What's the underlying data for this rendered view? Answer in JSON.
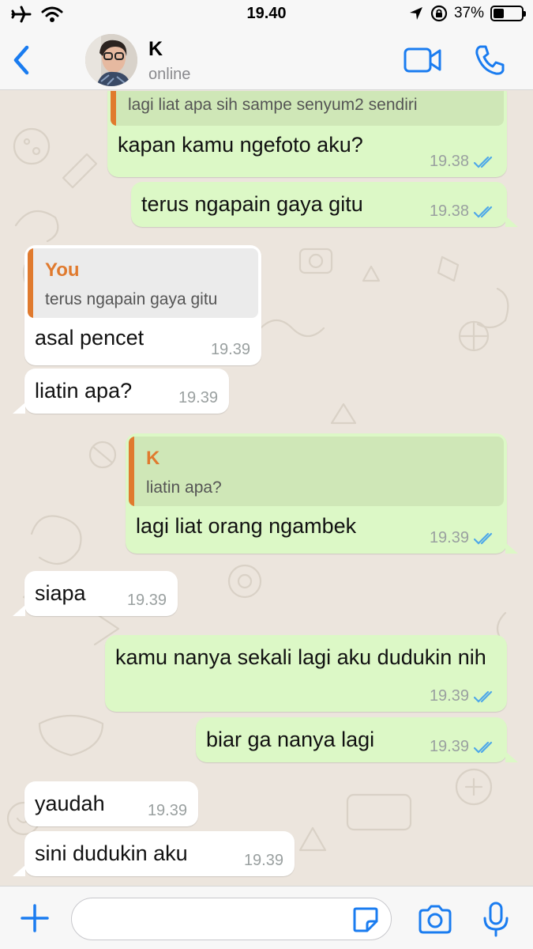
{
  "status_bar": {
    "time": "19.40",
    "battery_percent_label": "37%",
    "battery_level": 0.37,
    "icons": [
      "airplane-icon",
      "wifi-icon",
      "location-icon",
      "rotation-lock-icon",
      "battery-icon"
    ]
  },
  "header": {
    "contact_name": "K",
    "contact_status": "online",
    "icons": [
      "back-chevron-icon",
      "video-call-icon",
      "phone-call-icon"
    ]
  },
  "messages": [
    {
      "direction": "out",
      "quote_text": "lagi liat apa sih sampe senyum2 sendiri",
      "text": "kapan kamu ngefoto aku?",
      "time": "19.38",
      "status": "read"
    },
    {
      "direction": "out",
      "text": "terus ngapain gaya gitu",
      "time": "19.38",
      "status": "read"
    },
    {
      "direction": "in",
      "quote_author": "You",
      "quote_text": "terus ngapain gaya gitu",
      "text": "asal pencet",
      "time": "19.39"
    },
    {
      "direction": "in",
      "text": "liatin apa?",
      "time": "19.39"
    },
    {
      "direction": "out",
      "quote_author": "K",
      "quote_text": "liatin apa?",
      "text": "lagi liat orang ngambek",
      "time": "19.39",
      "status": "read"
    },
    {
      "direction": "in",
      "text": "siapa",
      "time": "19.39"
    },
    {
      "direction": "out",
      "text": "kamu nanya sekali lagi aku dudukin nih",
      "time": "19.39",
      "status": "read"
    },
    {
      "direction": "out",
      "text": "biar ga nanya lagi",
      "time": "19.39",
      "status": "read"
    },
    {
      "direction": "in",
      "text": "yaudah",
      "time": "19.39"
    },
    {
      "direction": "in",
      "text": "sini dudukin aku",
      "time": "19.39"
    }
  ],
  "input_bar": {
    "placeholder": "",
    "value": "",
    "icons": [
      "plus-icon",
      "sticker-icon",
      "camera-icon",
      "microphone-icon"
    ]
  },
  "colors": {
    "accent": "#1a7cf0",
    "outgoing_bubble": "#dcf8c6",
    "incoming_bubble": "#ffffff",
    "chat_background": "#ece5dd",
    "quote_bar": "#e07a2e",
    "read_ticks": "#4fa8e8"
  }
}
